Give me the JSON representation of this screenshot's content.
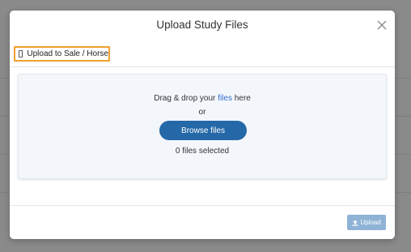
{
  "modal": {
    "title": "Upload Study Files",
    "close_icon": "close-icon"
  },
  "options": {
    "upload_to_sale_label": "Upload to Sale / Horse",
    "upload_to_sale_checked": false
  },
  "dropzone": {
    "drag_prefix": "Drag & drop your ",
    "files_link": "files",
    "drag_suffix": " here",
    "or_text": "or",
    "browse_label": "Browse files",
    "selected_count_text": "0 files selected"
  },
  "footer": {
    "upload_label": "Upload",
    "upload_icon": "upload-icon"
  },
  "colors": {
    "accent_blue": "#2468a8",
    "highlight_orange": "#f0a030",
    "link_blue": "#2f6fd0",
    "disabled_button": "#8fb3d6"
  }
}
